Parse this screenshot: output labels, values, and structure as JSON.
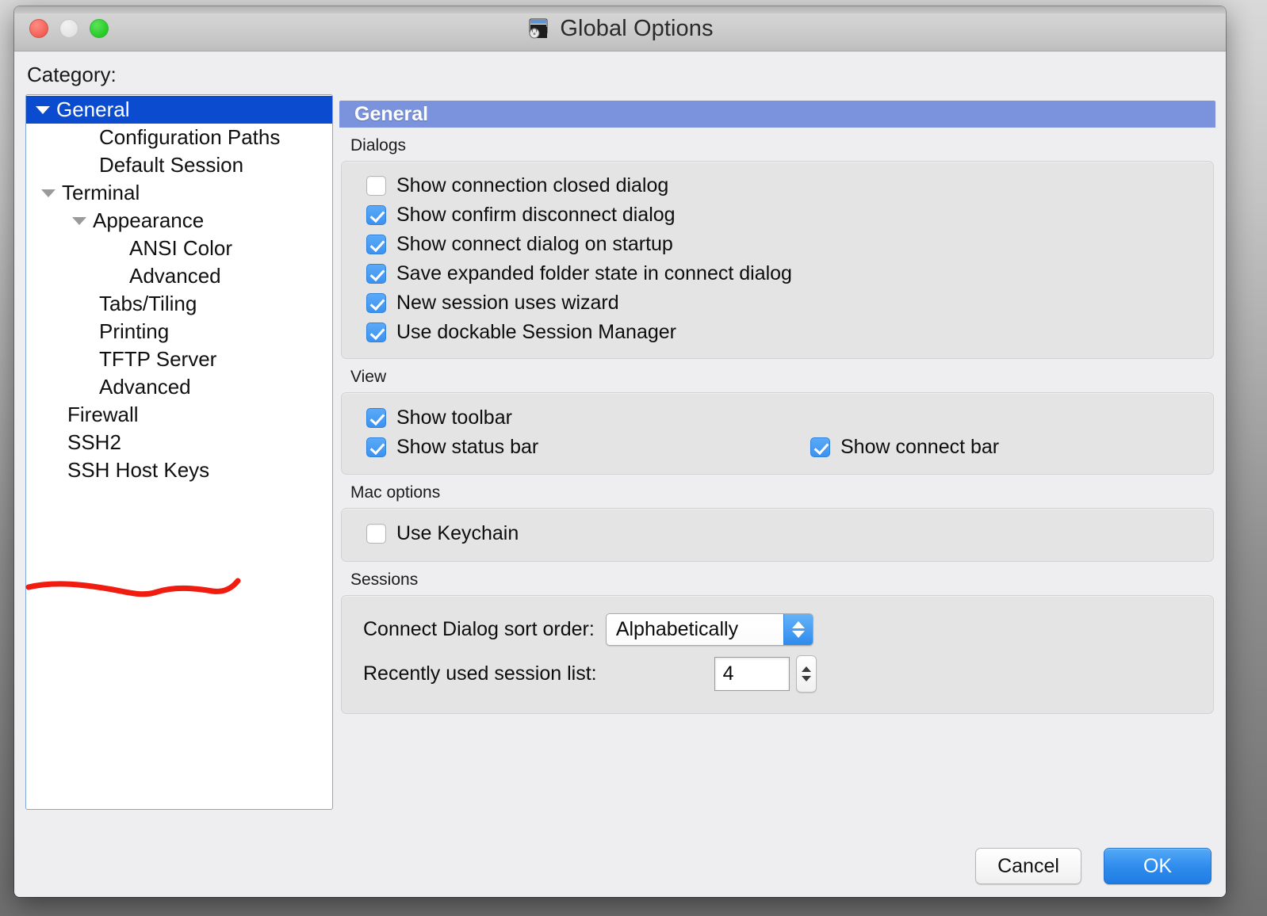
{
  "window": {
    "title": "Global Options",
    "title_icon": "app-window-lock-icon",
    "traffic_lights": [
      "close",
      "minimize",
      "zoom"
    ]
  },
  "sidebar": {
    "label": "Category:",
    "items": [
      {
        "label": "General",
        "indent": 0,
        "twisty": "down",
        "selected": true
      },
      {
        "label": "Configuration Paths",
        "indent": 2,
        "twisty": "none",
        "selected": false
      },
      {
        "label": "Default Session",
        "indent": 2,
        "twisty": "none",
        "selected": false
      },
      {
        "label": "Terminal",
        "indent": 0,
        "twisty": "down",
        "selected": false
      },
      {
        "label": "Appearance",
        "indent": 1,
        "twisty": "down",
        "selected": false
      },
      {
        "label": "ANSI Color",
        "indent": 3,
        "twisty": "none",
        "selected": false
      },
      {
        "label": "Advanced",
        "indent": 3,
        "twisty": "none",
        "selected": false
      },
      {
        "label": "Tabs/Tiling",
        "indent": 2,
        "twisty": "none",
        "selected": false
      },
      {
        "label": "Printing",
        "indent": 2,
        "twisty": "none",
        "selected": false
      },
      {
        "label": "TFTP Server",
        "indent": 2,
        "twisty": "none",
        "selected": false
      },
      {
        "label": "Advanced",
        "indent": 2,
        "twisty": "none",
        "selected": false
      },
      {
        "label": "Firewall",
        "indent": 1,
        "twisty": "none",
        "selected": false
      },
      {
        "label": "SSH2",
        "indent": 1,
        "twisty": "none",
        "selected": false
      },
      {
        "label": "SSH Host Keys",
        "indent": 1,
        "twisty": "none",
        "selected": false
      }
    ]
  },
  "panel": {
    "header": "General",
    "dialogs": {
      "title": "Dialogs",
      "options": [
        {
          "label": "Show connection closed dialog",
          "checked": false
        },
        {
          "label": "Show confirm disconnect dialog",
          "checked": true
        },
        {
          "label": "Show connect dialog on startup",
          "checked": true
        },
        {
          "label": "Save expanded folder state in connect dialog",
          "checked": true
        },
        {
          "label": "New session uses wizard",
          "checked": true
        },
        {
          "label": "Use dockable Session Manager",
          "checked": true
        }
      ]
    },
    "view": {
      "title": "View",
      "options_col1": [
        {
          "label": "Show toolbar",
          "checked": true
        },
        {
          "label": "Show status bar",
          "checked": true
        }
      ],
      "options_col2": [
        {
          "label": "Show connect bar",
          "checked": true
        }
      ]
    },
    "mac_options": {
      "title": "Mac options",
      "options": [
        {
          "label": "Use Keychain",
          "checked": false
        }
      ]
    },
    "sessions": {
      "title": "Sessions",
      "sort_order_label": "Connect Dialog sort order:",
      "sort_order_value": "Alphabetically",
      "recent_list_label": "Recently used session list:",
      "recent_list_value": "4"
    }
  },
  "footer": {
    "cancel_label": "Cancel",
    "ok_label": "OK"
  },
  "annotation": {
    "type": "hand-drawn-red-underline",
    "target": "Use Keychain",
    "color": "#f01c10"
  },
  "colors": {
    "selection_blue": "#0b4bd0",
    "header_blue": "#7a93dc",
    "checkbox_blue": "#3d92f0",
    "ok_button_blue": "#2f8ced",
    "annotation_red": "#f01c10"
  }
}
